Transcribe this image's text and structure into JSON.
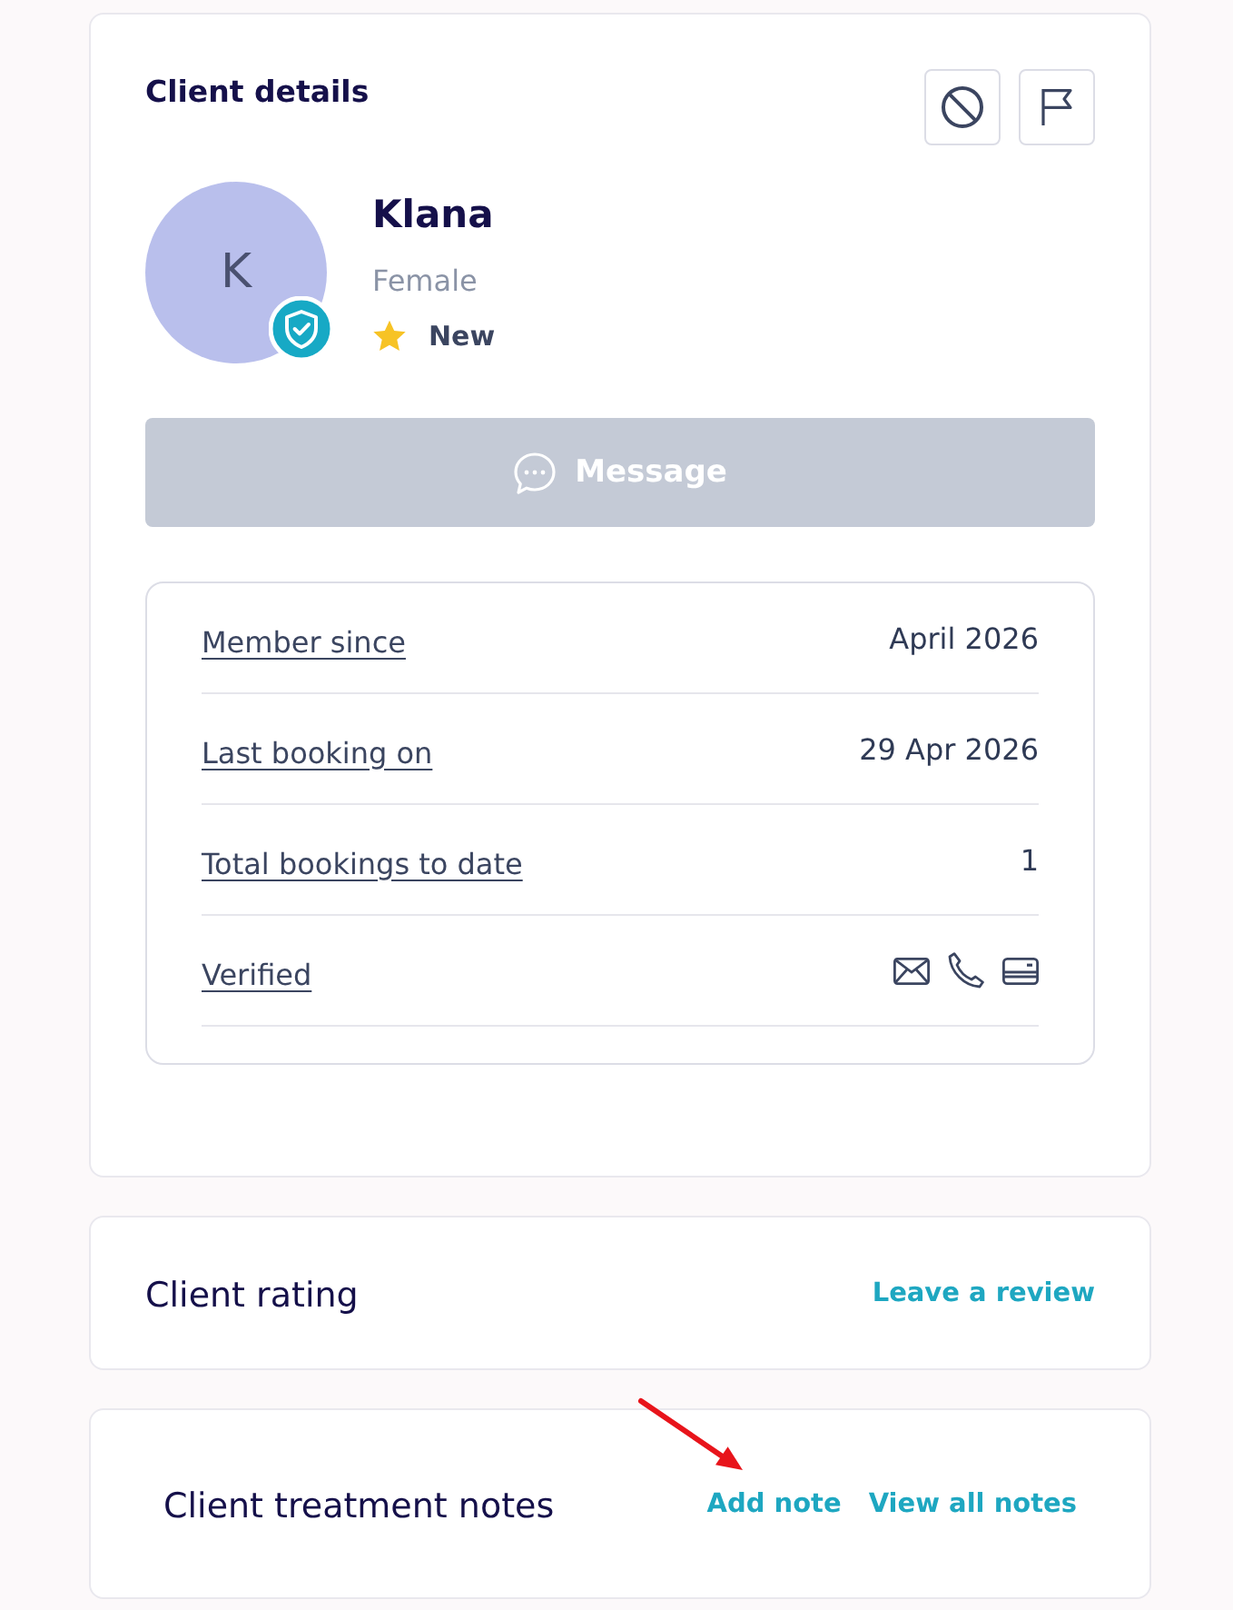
{
  "client_details": {
    "title": "Client details",
    "actions": [
      {
        "kind": "block"
      },
      {
        "kind": "flag"
      }
    ],
    "avatar": {
      "initial": "K",
      "verified": true
    },
    "name": "Klana",
    "gender": "Female",
    "status": "New",
    "message_button": {
      "label": "Message",
      "disabled": true
    },
    "info": [
      {
        "kind": "text",
        "label": "Member since",
        "value": "April 2026"
      },
      {
        "kind": "text",
        "label": "Last booking on",
        "value": "29 Apr 2026"
      },
      {
        "kind": "text",
        "label": "Total bookings to date",
        "value": "1"
      },
      {
        "kind": "icons",
        "label": "Verified",
        "items": [
          {
            "kind": "email"
          },
          {
            "kind": "phone"
          },
          {
            "kind": "card"
          }
        ]
      }
    ]
  },
  "client_rating": {
    "title": "Client rating",
    "links": [
      {
        "label": "Leave a review",
        "pointed_at": false
      }
    ]
  },
  "treatment_notes": {
    "title": "Client treatment notes",
    "links": [
      {
        "label": "Add note",
        "pointed_at": true
      },
      {
        "label": "View all notes",
        "pointed_at": false
      }
    ]
  }
}
